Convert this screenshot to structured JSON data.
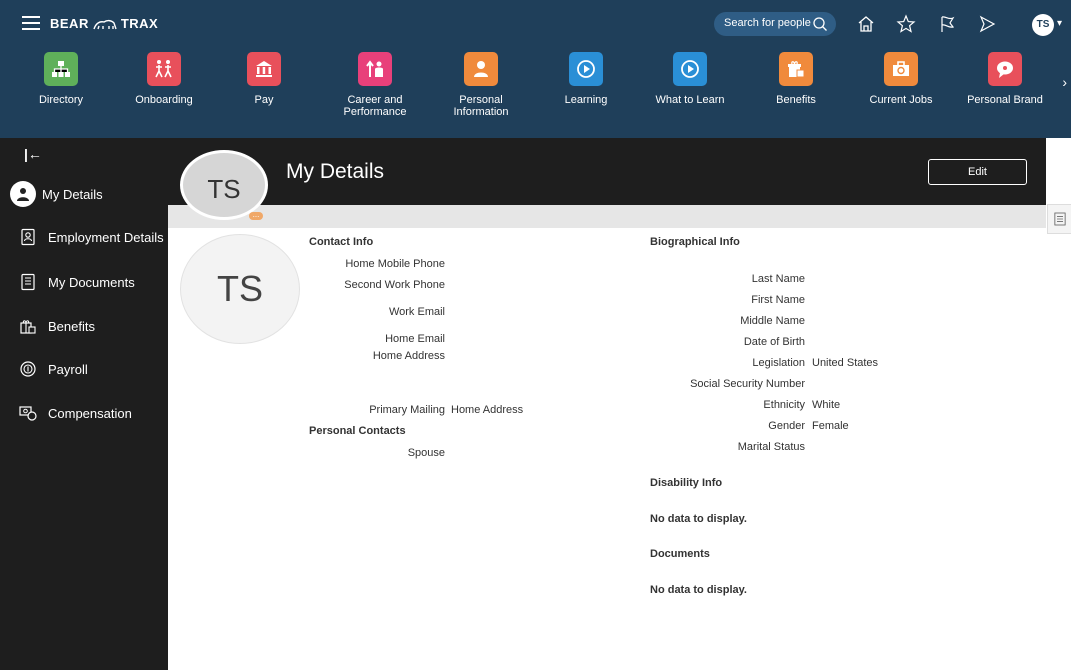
{
  "header": {
    "brand_left": "BEAR",
    "brand_right": "TRAX",
    "search_placeholder": "Search for people",
    "avatar_initials": "TS"
  },
  "apps": [
    {
      "label": "Directory",
      "color": "#5fb05a",
      "icon": "org-chart-icon"
    },
    {
      "label": "Onboarding",
      "color": "#e8505b",
      "icon": "people-walking-icon"
    },
    {
      "label": "Pay",
      "color": "#e8505b",
      "icon": "bank-icon"
    },
    {
      "label": "Career and Performance",
      "color": "#e8407a",
      "icon": "career-icon"
    },
    {
      "label": "Personal Information",
      "color": "#f08a3c",
      "icon": "person-card-icon"
    },
    {
      "label": "Learning",
      "color": "#2a8fd6",
      "icon": "play-icon"
    },
    {
      "label": "What to Learn",
      "color": "#2a8fd6",
      "icon": "play-icon"
    },
    {
      "label": "Benefits",
      "color": "#f08a3c",
      "icon": "gift-icon"
    },
    {
      "label": "Current Jobs",
      "color": "#f08a3c",
      "icon": "job-icon"
    },
    {
      "label": "Personal Brand",
      "color": "#e8505b",
      "icon": "chat-icon"
    }
  ],
  "sidebar": {
    "items": [
      {
        "label": "My Details",
        "icon": "person-icon",
        "active": true
      },
      {
        "label": "Employment Details",
        "icon": "badge-icon"
      },
      {
        "label": "My Documents",
        "icon": "document-icon"
      },
      {
        "label": "Benefits",
        "icon": "gift-icon"
      },
      {
        "label": "Payroll",
        "icon": "payroll-icon"
      },
      {
        "label": "Compensation",
        "icon": "compensation-icon"
      }
    ]
  },
  "page": {
    "title": "My Details",
    "edit_label": "Edit",
    "initials": "TS",
    "more_label": "..."
  },
  "contact": {
    "title": "Contact Info",
    "home_mobile_phone": "Home Mobile Phone",
    "second_work_phone": "Second Work Phone",
    "work_email": "Work Email",
    "home_email": "Home Email",
    "home_address": "Home Address",
    "primary_mailing_label": "Primary Mailing",
    "primary_mailing_value": "Home Address"
  },
  "personal_contacts": {
    "title": "Personal Contacts",
    "spouse": "Spouse"
  },
  "bio": {
    "title": "Biographical Info",
    "last_name": "Last Name",
    "first_name": "First Name",
    "middle_name": "Middle Name",
    "dob": "Date of Birth",
    "legislation_label": "Legislation",
    "legislation_value": "United States",
    "ssn": "Social Security Number",
    "ethnicity_label": "Ethnicity",
    "ethnicity_value": "White",
    "gender_label": "Gender",
    "gender_value": "Female",
    "marital_status": "Marital Status"
  },
  "disability": {
    "title": "Disability Info",
    "empty": "No data to display."
  },
  "documents": {
    "title": "Documents",
    "empty": "No data to display."
  }
}
